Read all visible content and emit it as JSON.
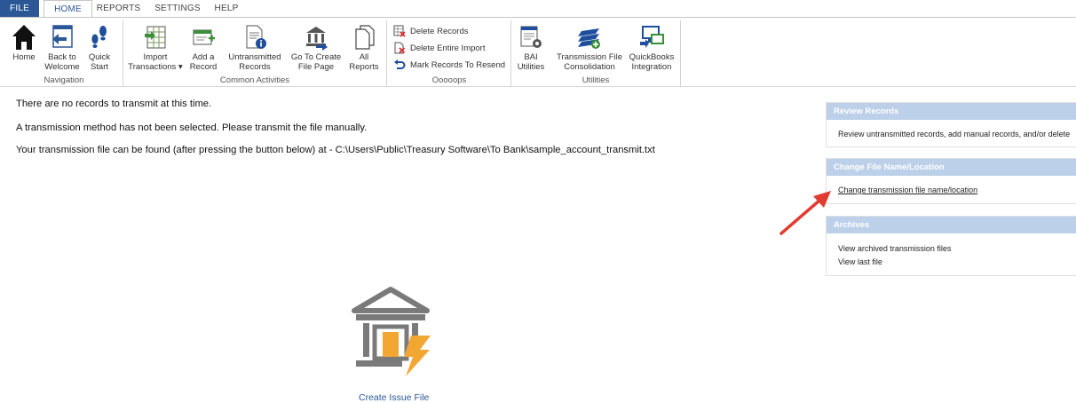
{
  "tabs": {
    "file": "FILE",
    "home": "HOME",
    "reports": "REPORTS",
    "settings": "SETTINGS",
    "help": "HELP"
  },
  "ribbon": {
    "groups": {
      "navigation": "Navigation",
      "common": "Common Activities",
      "oops": "Ooooops",
      "utilities": "Utilities"
    },
    "buttons": {
      "home": "Home",
      "back_line1": "Back to",
      "back_line2": "Welcome",
      "quick_line1": "Quick",
      "quick_line2": "Start",
      "import_line1": "Import",
      "import_line2": "Transactions ▾",
      "add_line1": "Add a",
      "add_line2": "Record",
      "untrans_line1": "Untransmitted",
      "untrans_line2": "Records",
      "goto_line1": "Go To Create",
      "goto_line2": "File Page",
      "all_line1": "All",
      "all_line2": "Reports",
      "delete_records": "Delete Records",
      "delete_import": "Delete Entire Import",
      "mark_resend": "Mark Records To Resend",
      "bai_line1": "BAI",
      "bai_line2": "Utilities",
      "consol_line1": "Transmission File",
      "consol_line2": "Consolidation",
      "qb_line1": "QuickBooks",
      "qb_line2": "Integration"
    }
  },
  "messages": {
    "line1": "There are no records to transmit at this time.",
    "line2": "A transmission method has not been selected.  Please transmit the file manually.",
    "line3": "Your transmission file can be found (after pressing the button below) at - C:\\Users\\Public\\Treasury Software\\To Bank\\sample_account_transmit.txt"
  },
  "panels": {
    "review_title": "Review Records",
    "review_text": "Review untransmitted records, add manual records, and/or delete",
    "change_title": "Change File Name/Location",
    "change_link": "Change transmission file name/location",
    "archives_title": "Archives",
    "archives_link1": "View archived transmission files",
    "archives_link2": "View last file"
  },
  "create_issue": "Create Issue File",
  "colors": {
    "accent": "#2b5797",
    "panel_header": "#bcd0ea",
    "arrow": "#e03c31",
    "lightning": "#f2a733"
  }
}
